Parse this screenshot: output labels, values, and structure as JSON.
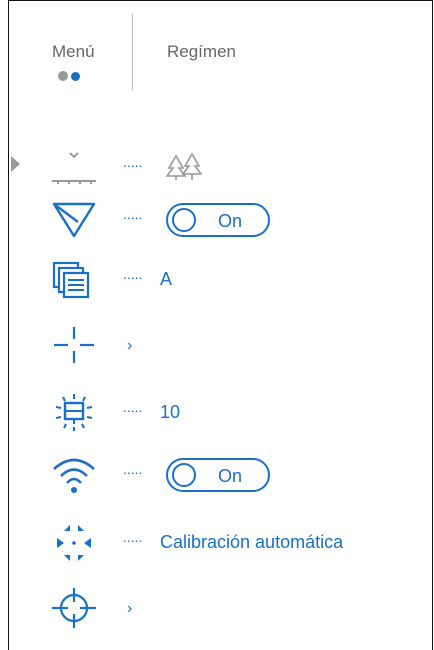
{
  "tabs": [
    {
      "label": "Menú"
    },
    {
      "label": "Regímen"
    }
  ],
  "menu_items": [
    {
      "icon": "terrain-mode-icon",
      "value": "",
      "value_icon": "forest-icon"
    },
    {
      "icon": "triangle-filter-icon",
      "value": "On",
      "type": "toggle"
    },
    {
      "icon": "picture-in-picture-icon",
      "value": "A"
    },
    {
      "icon": "crosshair-icon",
      "value": "›",
      "type": "submenu"
    },
    {
      "icon": "brightness-icon",
      "value": "10"
    },
    {
      "icon": "wifi-icon",
      "value": "On",
      "type": "toggle"
    },
    {
      "icon": "calibration-icon",
      "value": "Calibración automática"
    },
    {
      "icon": "zeroing-icon",
      "value": "›",
      "type": "submenu"
    }
  ],
  "colors": {
    "accent": "#1a6fc7",
    "muted": "#999999"
  }
}
